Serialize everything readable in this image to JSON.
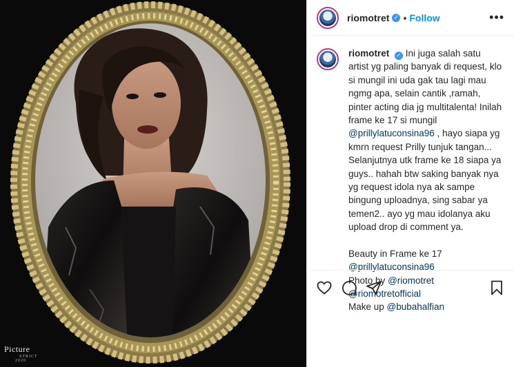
{
  "photo": {
    "watermark_title": "Picture",
    "watermark_subtitle": "STRICT",
    "watermark_year": "2020"
  },
  "header": {
    "username": "riomotret",
    "separator": "•",
    "follow_label": "Follow",
    "more_label": "•••"
  },
  "caption": {
    "username": "riomotret",
    "text1": "Ini juga salah satu artist yg paling banyak di request, klo si mungil ini uda gak tau lagi mau ngmg apa, selain cantik ,ramah, pinter acting dia jg multitalenta! Inilah frame ke 17 si mungil",
    "mention1": "@prillylatuconsina96",
    "text2": ", hayo siapa yg kmrn request Prilly tunjuk tangan... Selanjutnya utk frame ke 18 siapa ya guys.. hahah btw saking banyak nya yg request idola nya ak sampe bingung uploadnya, sing sabar ya temen2.. ayo yg mau idolanya aku upload drop di comment ya.",
    "line_beauty": "Beauty in Frame ke 17",
    "mention2": "@prillylatuconsina96",
    "photo_by": "Photo by",
    "mention3": "@riomotret",
    "mention4": "@riomotretofficial",
    "makeup_by": "Make up",
    "mention5": "@bubahalfian"
  },
  "icons": {
    "like": "heart-icon",
    "comment": "comment-icon",
    "share": "share-icon",
    "save": "bookmark-icon",
    "verified": "verified-badge-icon",
    "more": "more-options-icon"
  },
  "colors": {
    "accent": "#0095f6",
    "mention": "#00376b",
    "verified": "#3897f0",
    "frame_gold": "#b8a262",
    "photo_bg": "#0a0a0a"
  }
}
